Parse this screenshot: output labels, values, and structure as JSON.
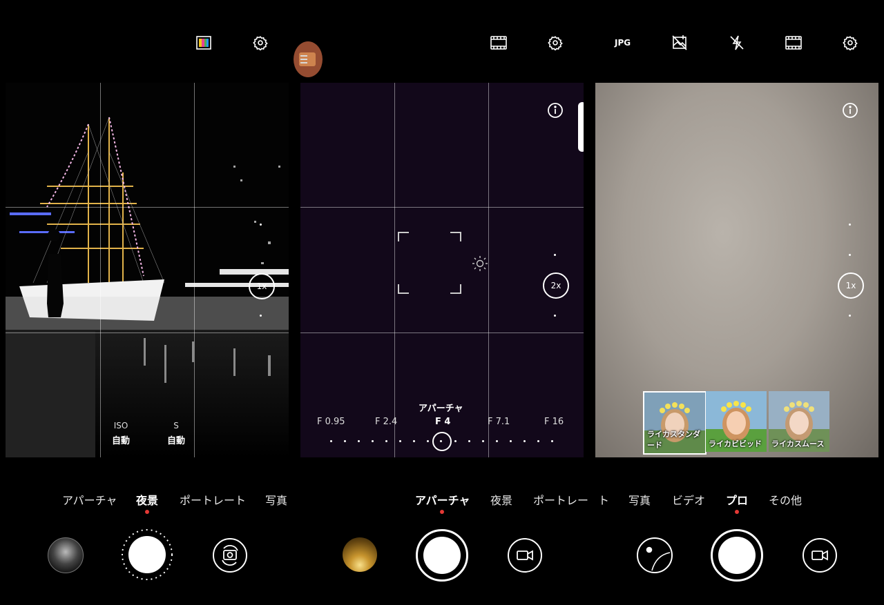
{
  "panel1": {
    "iso_label": "ISO",
    "iso_value": "自動",
    "shutter_label": "S",
    "shutter_value": "自動",
    "zoom_label": "1x",
    "modes": [
      "アパーチャ",
      "夜景",
      "ポートレート",
      "写真"
    ],
    "selected_mode": "夜景"
  },
  "panel2": {
    "slider_title": "アパーチャ",
    "f_values": [
      "F 0.95",
      "F 2.4",
      "F 4",
      "F 7.1",
      "F 16"
    ],
    "selected_f": "F 4",
    "zoom_label": "2x",
    "modes": [
      "アパーチャ",
      "夜景",
      "ポートレー",
      "ト"
    ],
    "selected_mode": "アパーチャ"
  },
  "panel3": {
    "format_label": "JPG",
    "zoom_label": "1x",
    "modes": [
      "写真",
      "ビデオ",
      "プロ",
      "その他"
    ],
    "selected_mode": "プロ",
    "filters": [
      {
        "label": "ライカスタンダード",
        "selected": true
      },
      {
        "label": "ライカビビッド",
        "selected": false
      },
      {
        "label": "ライカスムース",
        "selected": false
      }
    ]
  },
  "colors": {
    "accent_red": "#e53935",
    "panel2_bg": "#12081a",
    "panel3_bg": "#a39d95"
  },
  "icons": [
    "film-filter-icon",
    "gear-icon",
    "film-strip-icon",
    "info-icon",
    "brightness-icon",
    "no-watermark-icon",
    "flash-off-icon",
    "switch-camera-icon",
    "video-camera-icon",
    "lens-switch-icon"
  ]
}
